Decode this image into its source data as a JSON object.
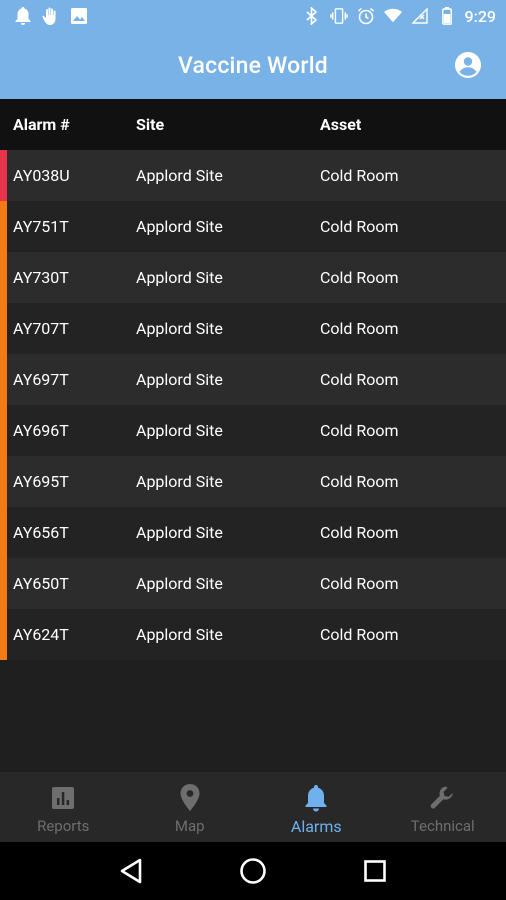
{
  "status_bar": {
    "time": "9:29",
    "left_icons": [
      "notification-bell-icon",
      "hand-icon",
      "image-icon"
    ],
    "right_icons": [
      "bluetooth-icon",
      "vibrate-icon",
      "alarm-clock-icon",
      "wifi-icon",
      "no-signal-icon",
      "battery-icon"
    ]
  },
  "app_bar": {
    "title": "Vaccine World",
    "account_icon": "account-circle-icon"
  },
  "table": {
    "headers": {
      "alarm": "Alarm #",
      "site": "Site",
      "asset": "Asset"
    },
    "rows": [
      {
        "alarm": "AY038U",
        "site": "Applord Site",
        "asset": "Cold Room",
        "severity_color": "#e8344a"
      },
      {
        "alarm": "AY751T",
        "site": "Applord Site",
        "asset": "Cold Room",
        "severity_color": "#f47a16"
      },
      {
        "alarm": "AY730T",
        "site": "Applord Site",
        "asset": "Cold Room",
        "severity_color": "#f47a16"
      },
      {
        "alarm": "AY707T",
        "site": "Applord Site",
        "asset": "Cold Room",
        "severity_color": "#f47a16"
      },
      {
        "alarm": "AY697T",
        "site": "Applord Site",
        "asset": "Cold Room",
        "severity_color": "#f47a16"
      },
      {
        "alarm": "AY696T",
        "site": "Applord Site",
        "asset": "Cold Room",
        "severity_color": "#f47a16"
      },
      {
        "alarm": "AY695T",
        "site": "Applord Site",
        "asset": "Cold Room",
        "severity_color": "#f47a16"
      },
      {
        "alarm": "AY656T",
        "site": "Applord Site",
        "asset": "Cold Room",
        "severity_color": "#f47a16"
      },
      {
        "alarm": "AY650T",
        "site": "Applord Site",
        "asset": "Cold Room",
        "severity_color": "#f47a16"
      },
      {
        "alarm": "AY624T",
        "site": "Applord Site",
        "asset": "Cold Room",
        "severity_color": "#f47a16"
      }
    ]
  },
  "bottom_nav": {
    "items": [
      {
        "label": "Reports",
        "icon": "reports-chart-icon",
        "active": false
      },
      {
        "label": "Map",
        "icon": "map-pin-icon",
        "active": false
      },
      {
        "label": "Alarms",
        "icon": "bell-icon",
        "active": true
      },
      {
        "label": "Technical",
        "icon": "wrench-icon",
        "active": false
      }
    ]
  },
  "colors": {
    "app_bar": "#79b2e6",
    "accent": "#6fb1ee",
    "critical": "#e8344a",
    "warning": "#f47a16"
  }
}
